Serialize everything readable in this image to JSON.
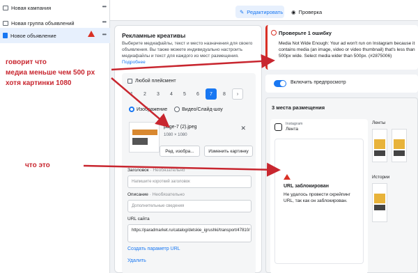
{
  "leftnav": {
    "items": [
      {
        "label": "Новая кампания"
      },
      {
        "label": "Новая группа объявлений"
      },
      {
        "label": "Новое объявление"
      }
    ]
  },
  "topbar": {
    "edit_label": "Редактировать",
    "check_label": "Проверка"
  },
  "creatives": {
    "title": "Рекламные креативы",
    "desc": "Выберите медиафайлы, текст и место назначения для своего объявления. Вы также можете индивидуально настроить медиафайлы и текст для каждого из мест размещения.",
    "more": "Подробнее",
    "placement_label": "Любой плейсмент",
    "pages": [
      "1",
      "2",
      "3",
      "4",
      "5",
      "6",
      "7",
      "8"
    ],
    "active_page": "7",
    "radio_image": "Изображение",
    "radio_video": "Видео/Слайд-шоу",
    "file_name": "page-7 (2).jpeg",
    "file_dims": "1080 × 1080",
    "edit_image_btn": "Ред. изобра...",
    "change_image_btn": "Изменить картинку",
    "headline_label": "Заголовок",
    "headline_opt": "· Необязательно",
    "headline_ph": "Напишите короткий заголовок",
    "desc_label": "Описание",
    "desc_opt": "· Необязательно",
    "desc_ph": "Дополнительные сведения",
    "url_label": "URL сайта",
    "url_value": "https://paradmarket.ru/catalog/detskie_igrushki/transport/47810/",
    "create_param": "Создать параметр URL",
    "delete": "Удалить"
  },
  "error": {
    "title": "Проверьте 1 ошибку",
    "text": "Media Not Wide Enough: Your ad won't run on Instagram because it contains media (an image, video or video thumbnail) that's less than 500px wide. Select media wider than 500px. (#2875006)"
  },
  "preview": {
    "toggle_label": "Включить предпросмотр"
  },
  "placements": {
    "title": "3 места размещения",
    "ig_small": "Instagram",
    "ig_feed": "Лента",
    "blocked_title": "URL заблокирован",
    "blocked_text": "Не удалось провести скрейпинг URL, так как он заблокирован.",
    "feeds_label": "Ленты",
    "stories_label": "Истории"
  },
  "annotations": {
    "line1": "говорит что",
    "line2": "медиа меньше чем 500 px",
    "line3": "хотя картинки 1080",
    "question": "что это"
  },
  "colors": {
    "accent": "#1877f2",
    "error": "#d93025",
    "annotation": "#c8262f"
  }
}
